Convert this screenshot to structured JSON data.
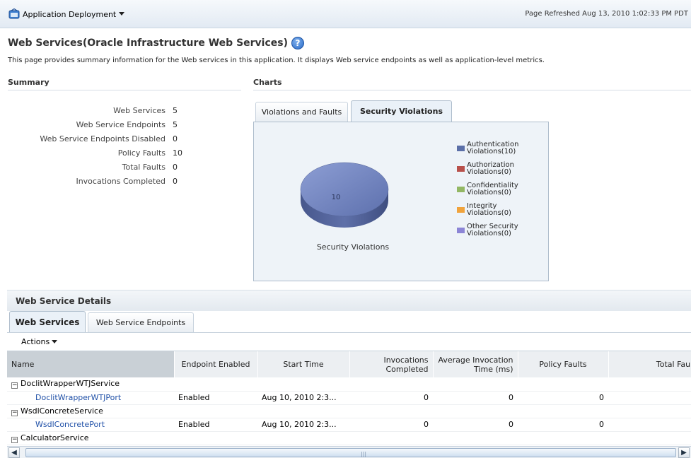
{
  "header": {
    "menu_label": "Application Deployment",
    "refreshed": "Page Refreshed Aug 13, 2010 1:02:33 PM PDT"
  },
  "page": {
    "title": "Web Services(Oracle Infrastructure Web Services)",
    "description": "This page provides summary information for the Web services in this application. It displays Web service endpoints as well as application-level metrics."
  },
  "summary": {
    "heading": "Summary",
    "rows": [
      {
        "label": "Web Services",
        "value": "5"
      },
      {
        "label": "Web Service Endpoints",
        "value": "5"
      },
      {
        "label": "Web Service Endpoints Disabled",
        "value": "0"
      },
      {
        "label": "Policy Faults",
        "value": "10"
      },
      {
        "label": "Total Faults",
        "value": "0"
      },
      {
        "label": "Invocations Completed",
        "value": "0"
      }
    ]
  },
  "charts": {
    "heading": "Charts",
    "tabs": [
      {
        "label": "Violations and Faults",
        "active": false
      },
      {
        "label": "Security Violations",
        "active": true
      }
    ]
  },
  "chart_data": {
    "type": "pie",
    "title": "Security Violations",
    "categories": [
      "Authentication Violations",
      "Authorization Violations",
      "Confidentiality Violations",
      "Integrity Violations",
      "Other Security Violations"
    ],
    "values": [
      10,
      0,
      0,
      0,
      0
    ],
    "slice_labels": [
      "10"
    ],
    "legend": [
      {
        "line1": "Authentication",
        "line2": "Violations(10)",
        "color": "#5b6fa8"
      },
      {
        "line1": "Authorization",
        "line2": "Violations(0)",
        "color": "#b8504b"
      },
      {
        "line1": "Confidentiality",
        "line2": "Violations(0)",
        "color": "#93b764"
      },
      {
        "line1": "Integrity",
        "line2": "Violations(0)",
        "color": "#f0a33c"
      },
      {
        "line1": "Other Security",
        "line2": "Violations(0)",
        "color": "#8c85d6"
      }
    ],
    "legend_position": "right"
  },
  "details": {
    "title": "Web Service Details",
    "tabs": [
      {
        "label": "Web Services",
        "active": true
      },
      {
        "label": "Web Service Endpoints",
        "active": false
      }
    ],
    "actions_label": "Actions",
    "columns": [
      "Name",
      "Endpoint Enabled",
      "Start Time",
      "Invocations Completed",
      "Average Invocation Time (ms)",
      "Policy Faults",
      "Total Fault"
    ],
    "rows": [
      {
        "type": "group",
        "name": "DoclitWrapperWTJService"
      },
      {
        "type": "port",
        "name": "DoclitWrapperWTJPort",
        "enabled": "Enabled",
        "start": "Aug 10, 2010 2:3...",
        "invocations": "0",
        "avg": "0",
        "policy": "0"
      },
      {
        "type": "group",
        "name": "WsdlConcreteService"
      },
      {
        "type": "port",
        "name": "WsdlConcretePort",
        "enabled": "Enabled",
        "start": "Aug 10, 2010 2:3...",
        "invocations": "0",
        "avg": "0",
        "policy": "0"
      },
      {
        "type": "group",
        "name": "CalculatorService"
      }
    ]
  },
  "colors": {
    "link": "#2151a8",
    "sorted_header": "#c9d0d6",
    "panel": "#eef3f8"
  }
}
